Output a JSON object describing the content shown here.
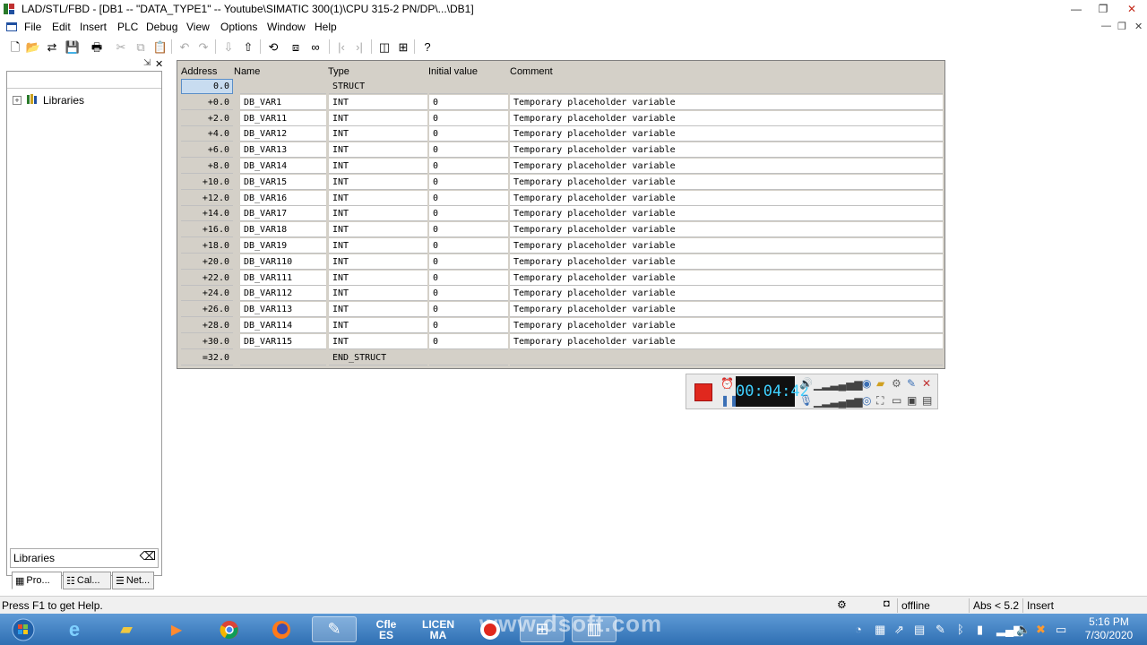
{
  "window": {
    "title": "LAD/STL/FBD  - [DB1 -- \"DATA_TYPE1\" -- Youtube\\SIMATIC 300(1)\\CPU 315-2 PN/DP\\...\\DB1]",
    "minimize": "—",
    "restore": "❐",
    "close": "✕"
  },
  "menu": {
    "items": [
      "File",
      "Edit",
      "Insert",
      "PLC",
      "Debug",
      "View",
      "Options",
      "Window",
      "Help"
    ]
  },
  "left_pane": {
    "tree_root": "Libraries",
    "search_value": "Libraries",
    "tabs": [
      "Pro...",
      "Cal...",
      "Net..."
    ]
  },
  "table": {
    "headers": {
      "address": "Address",
      "name": "Name",
      "type": "Type",
      "initial": "Initial value",
      "comment": "Comment"
    },
    "rows": [
      {
        "address": "0.0",
        "name": "",
        "type": "STRUCT",
        "initial": "",
        "comment": ""
      },
      {
        "address": "+0.0",
        "name": "DB_VAR1",
        "type": "INT",
        "initial": "0",
        "comment": "Temporary placeholder variable"
      },
      {
        "address": "+2.0",
        "name": "DB_VAR11",
        "type": "INT",
        "initial": "0",
        "comment": "Temporary placeholder variable"
      },
      {
        "address": "+4.0",
        "name": "DB_VAR12",
        "type": "INT",
        "initial": "0",
        "comment": "Temporary placeholder variable"
      },
      {
        "address": "+6.0",
        "name": "DB_VAR13",
        "type": "INT",
        "initial": "0",
        "comment": "Temporary placeholder variable"
      },
      {
        "address": "+8.0",
        "name": "DB_VAR14",
        "type": "INT",
        "initial": "0",
        "comment": "Temporary placeholder variable"
      },
      {
        "address": "+10.0",
        "name": "DB_VAR15",
        "type": "INT",
        "initial": "0",
        "comment": "Temporary placeholder variable"
      },
      {
        "address": "+12.0",
        "name": "DB_VAR16",
        "type": "INT",
        "initial": "0",
        "comment": "Temporary placeholder variable"
      },
      {
        "address": "+14.0",
        "name": "DB_VAR17",
        "type": "INT",
        "initial": "0",
        "comment": "Temporary placeholder variable"
      },
      {
        "address": "+16.0",
        "name": "DB_VAR18",
        "type": "INT",
        "initial": "0",
        "comment": "Temporary placeholder variable"
      },
      {
        "address": "+18.0",
        "name": "DB_VAR19",
        "type": "INT",
        "initial": "0",
        "comment": "Temporary placeholder variable"
      },
      {
        "address": "+20.0",
        "name": "DB_VAR110",
        "type": "INT",
        "initial": "0",
        "comment": "Temporary placeholder variable"
      },
      {
        "address": "+22.0",
        "name": "DB_VAR111",
        "type": "INT",
        "initial": "0",
        "comment": "Temporary placeholder variable"
      },
      {
        "address": "+24.0",
        "name": "DB_VAR112",
        "type": "INT",
        "initial": "0",
        "comment": "Temporary placeholder variable"
      },
      {
        "address": "+26.0",
        "name": "DB_VAR113",
        "type": "INT",
        "initial": "0",
        "comment": "Temporary placeholder variable"
      },
      {
        "address": "+28.0",
        "name": "DB_VAR114",
        "type": "INT",
        "initial": "0",
        "comment": "Temporary placeholder variable"
      },
      {
        "address": "+30.0",
        "name": "DB_VAR115",
        "type": "INT",
        "initial": "0",
        "comment": "Temporary placeholder variable"
      },
      {
        "address": "=32.0",
        "name": "",
        "type": "END_STRUCT",
        "initial": "",
        "comment": ""
      }
    ]
  },
  "recorder": {
    "timer": "00:04:42"
  },
  "status": {
    "help": "Press F1 to get Help.",
    "mode": "offline",
    "abs": "Abs < 5.2",
    "insert": "Insert"
  },
  "taskbar": {
    "cfle_label": "Cfle\nES",
    "licen_label": "LICEN\nMA",
    "watermark": "www.dsoft.com",
    "time": "5:16 PM",
    "date": "7/30/2020"
  },
  "colors": {
    "grid_bg": "#d4d0c8",
    "taskbar": "#2f6fb2",
    "record_red": "#e0281e"
  }
}
